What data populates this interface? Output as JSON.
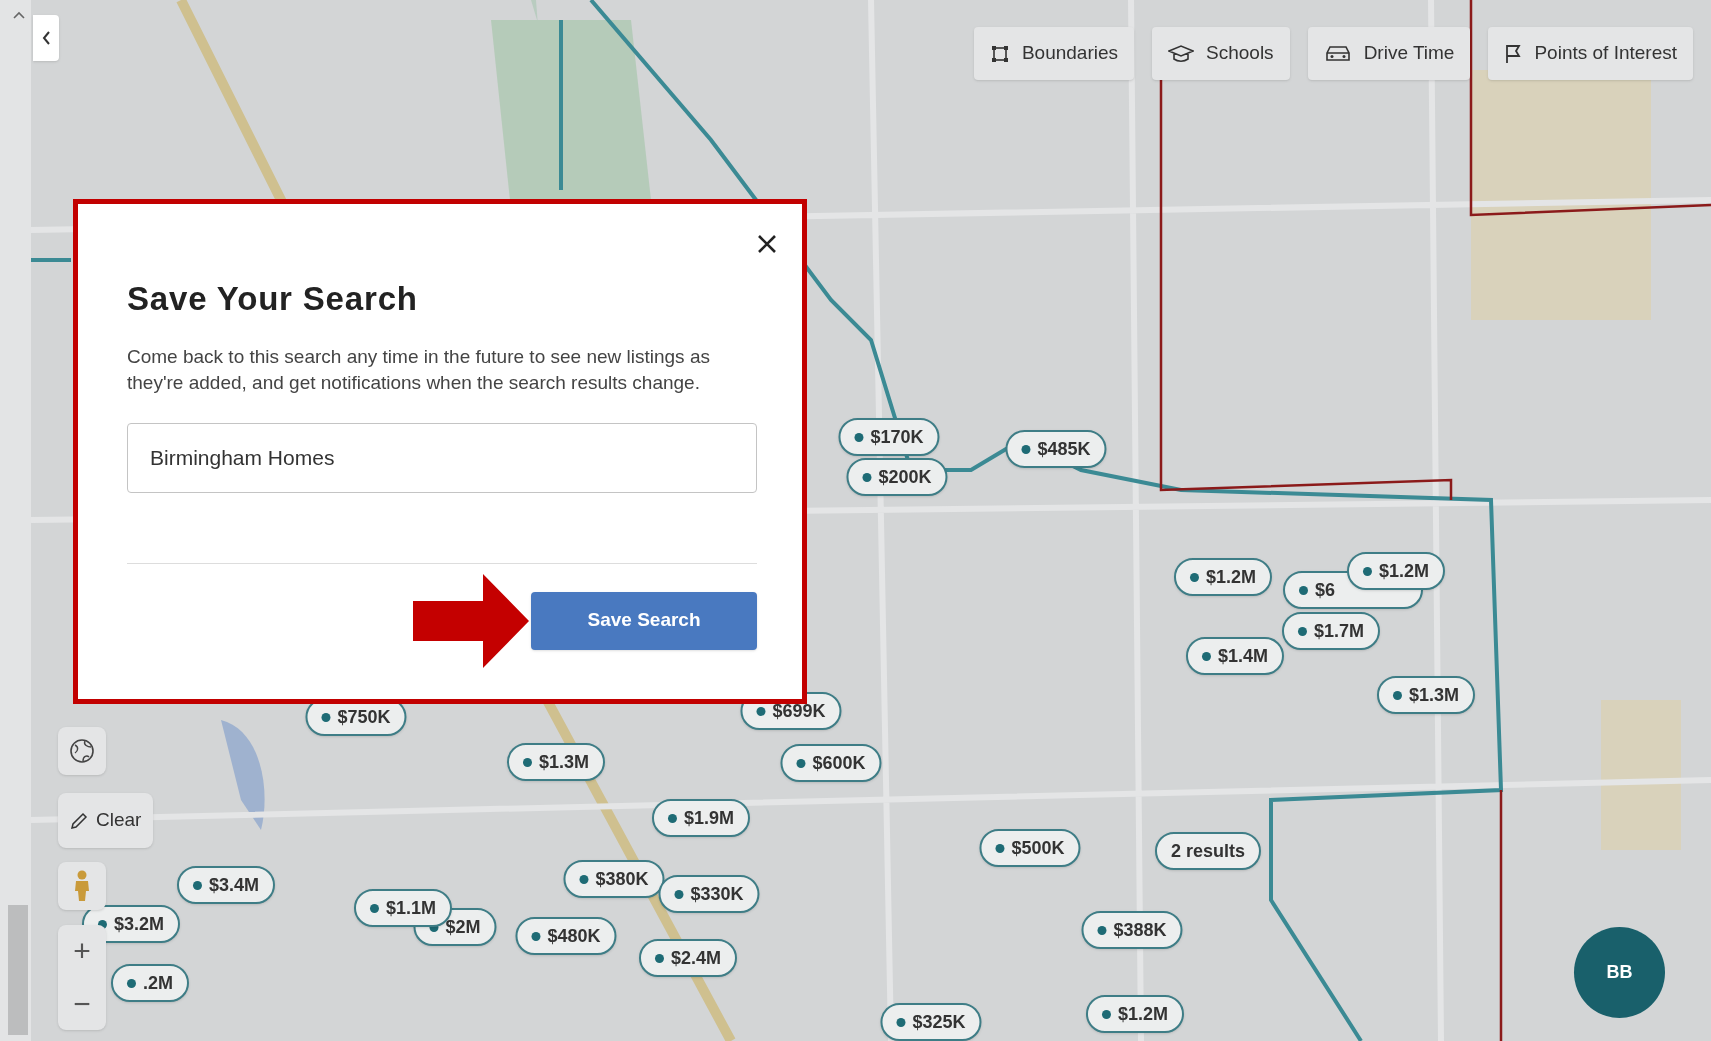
{
  "toolbar": [
    {
      "label": "Boundaries"
    },
    {
      "label": "Schools"
    },
    {
      "label": "Drive Time"
    },
    {
      "label": "Points of Interest"
    }
  ],
  "map_controls": {
    "clear_button": "Clear",
    "zoom_in": "+",
    "zoom_out": "−"
  },
  "markers": [
    {
      "label": "$170K"
    },
    {
      "label": "$200K"
    },
    {
      "label": "$485K"
    },
    {
      "label": "$1.2M"
    },
    {
      "label": "$6"
    },
    {
      "label": "$1.2M"
    },
    {
      "label": "$1.7M"
    },
    {
      "label": "$1.4M"
    },
    {
      "label": "$1.3M"
    },
    {
      "label": "$699K"
    },
    {
      "label": "$600K"
    },
    {
      "label": "$750K"
    },
    {
      "label": "$1.3M"
    },
    {
      "label": "$1.9M"
    },
    {
      "label": "$500K"
    },
    {
      "label": "2 results"
    },
    {
      "label": "$3.4M"
    },
    {
      "label": "$380K"
    },
    {
      "label": "$330K"
    },
    {
      "label": "$2M"
    },
    {
      "label": "$1.1M"
    },
    {
      "label": "$480K"
    },
    {
      "label": "$3.2M"
    },
    {
      "label": "$2.4M"
    },
    {
      "label": "$388K"
    },
    {
      "label": "$1.2M"
    },
    {
      "label": "$325K"
    },
    {
      "label": ".2M"
    }
  ],
  "avatar": {
    "initials": "BB"
  },
  "modal": {
    "title": "Save Your Search",
    "description": "Come back to this search any time in the future to see new listings as they're added, and get notifications when the search results change.",
    "input": {
      "value": "Birmingham Homes"
    },
    "save_button": "Save Search"
  }
}
